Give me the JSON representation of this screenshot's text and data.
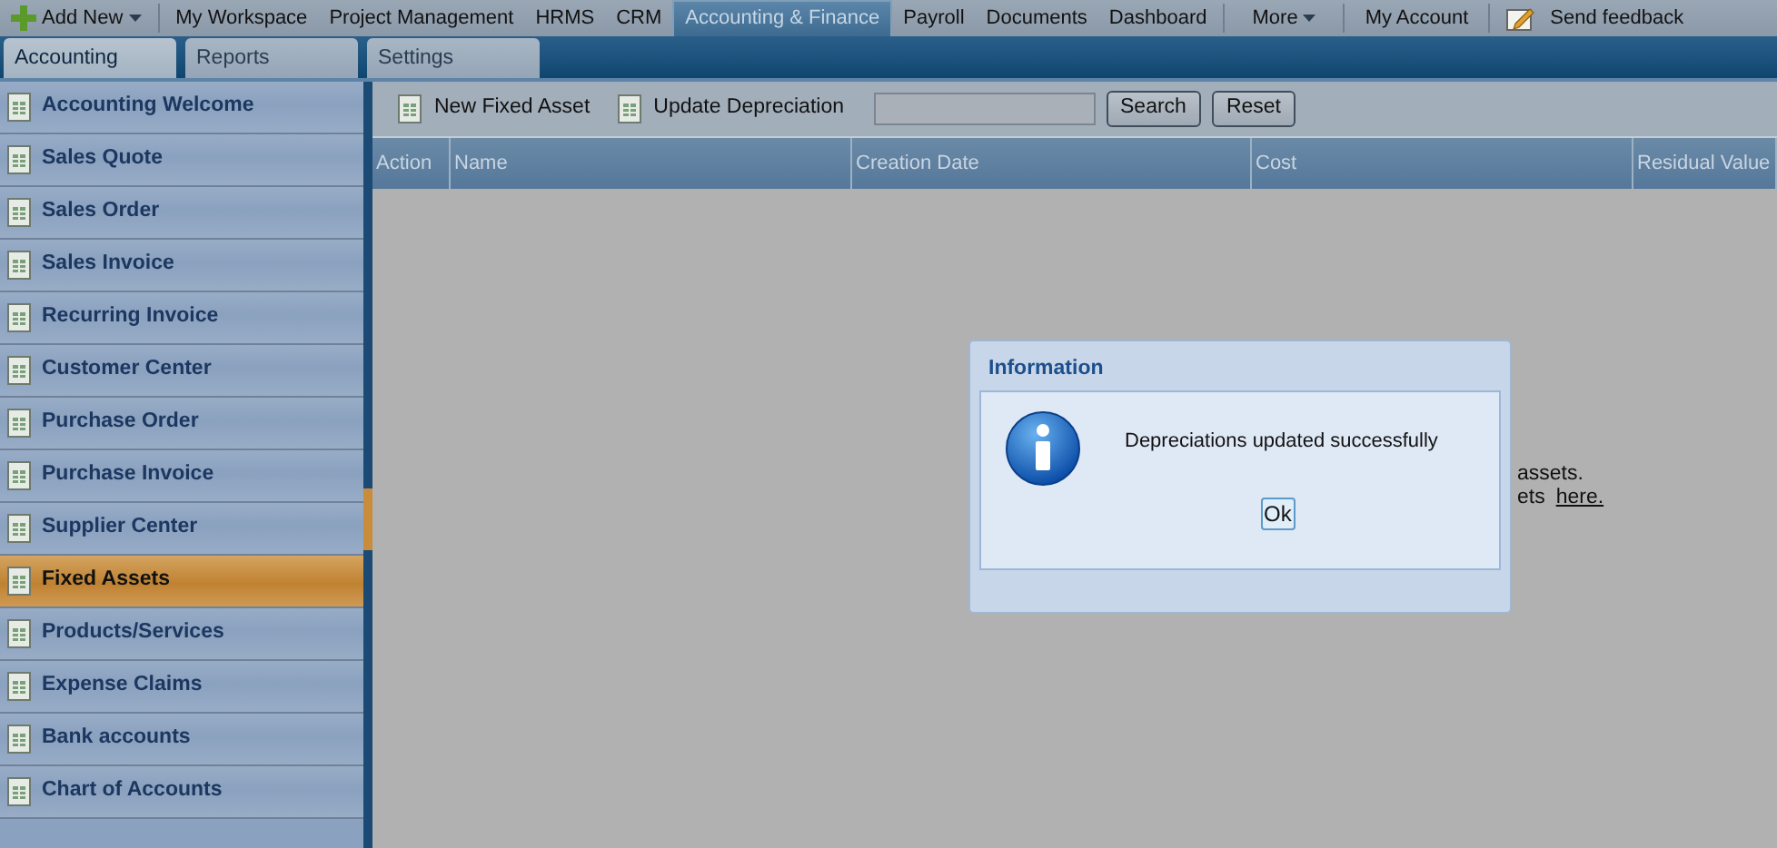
{
  "top_nav": {
    "add_new": "Add New",
    "items": [
      {
        "label": "My Workspace",
        "selected": false
      },
      {
        "label": "Project Management",
        "selected": false
      },
      {
        "label": "HRMS",
        "selected": false
      },
      {
        "label": "CRM",
        "selected": false
      },
      {
        "label": "Accounting & Finance",
        "selected": true
      },
      {
        "label": "Payroll",
        "selected": false
      },
      {
        "label": "Documents",
        "selected": false
      },
      {
        "label": "Dashboard",
        "selected": false
      }
    ],
    "more": "More",
    "account": "My Account",
    "feedback": "Send feedback"
  },
  "sub_tabs": [
    {
      "label": "Accounting",
      "selected": true
    },
    {
      "label": "Reports",
      "selected": false
    },
    {
      "label": "Settings",
      "selected": false
    }
  ],
  "sidebar": {
    "items": [
      {
        "label": "Accounting Welcome",
        "selected": false
      },
      {
        "label": "Sales Quote",
        "selected": false
      },
      {
        "label": "Sales Order",
        "selected": false
      },
      {
        "label": "Sales Invoice",
        "selected": false
      },
      {
        "label": "Recurring Invoice",
        "selected": false
      },
      {
        "label": "Customer Center",
        "selected": false
      },
      {
        "label": "Purchase Order",
        "selected": false
      },
      {
        "label": "Purchase Invoice",
        "selected": false
      },
      {
        "label": "Supplier Center",
        "selected": false
      },
      {
        "label": "Fixed Assets",
        "selected": true
      },
      {
        "label": "Products/Services",
        "selected": false
      },
      {
        "label": "Expense Claims",
        "selected": false
      },
      {
        "label": "Bank accounts",
        "selected": false
      },
      {
        "label": "Chart of Accounts",
        "selected": false
      }
    ]
  },
  "toolbar": {
    "buttons": [
      "New Fixed Asset",
      "Update Depreciation"
    ],
    "search_button": "Search",
    "reset_button": "Reset"
  },
  "table": {
    "columns": [
      "Action",
      "Name",
      "Creation Date",
      "Cost",
      "Residual Value"
    ]
  },
  "empty_message": {
    "line_1": "assets.",
    "line_2": "ets",
    "link": "here."
  },
  "dialog": {
    "title": "Information",
    "message": "Depreciations updated successfully",
    "ok": "Ok"
  }
}
